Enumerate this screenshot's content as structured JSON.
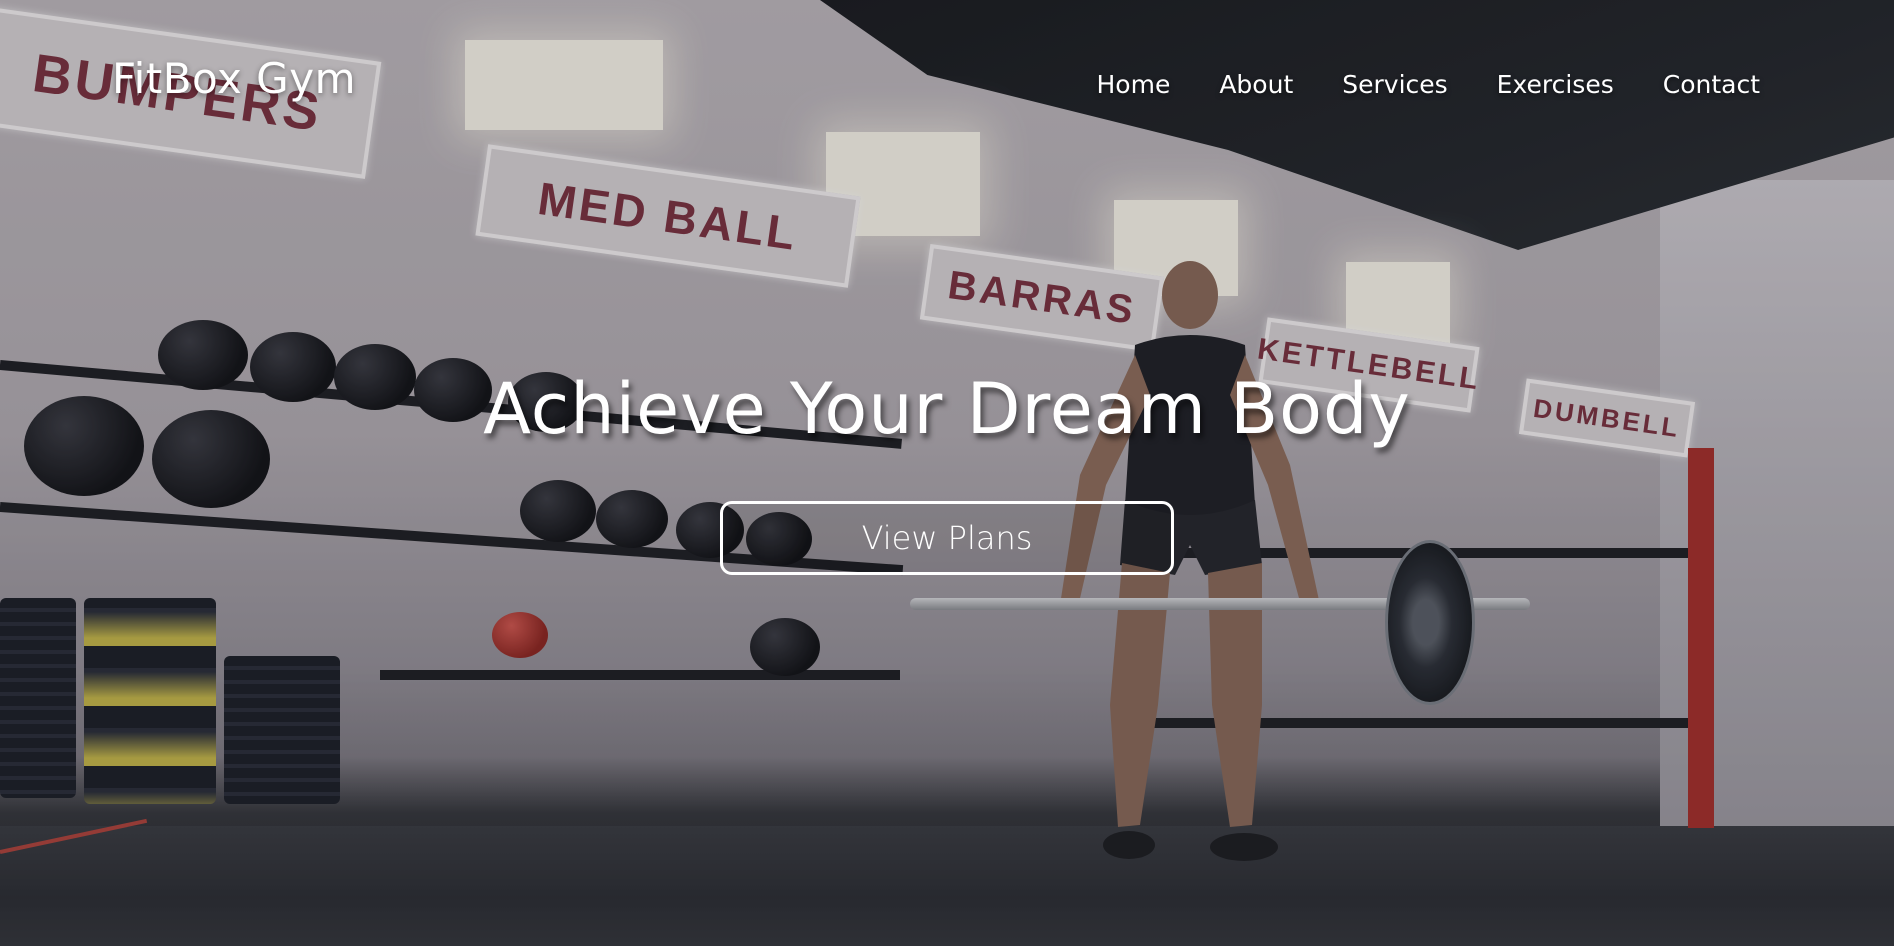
{
  "site": {
    "logo": "FitBox Gym"
  },
  "nav": {
    "items": [
      {
        "label": "Home"
      },
      {
        "label": "About"
      },
      {
        "label": "Services"
      },
      {
        "label": "Exercises"
      },
      {
        "label": "Contact"
      }
    ]
  },
  "hero": {
    "title": "Achieve Your Dream Body",
    "cta_label": "View Plans",
    "background": {
      "signs": [
        "BUMPERS",
        "MED BALL",
        "BARRAS",
        "KETTLEBELL",
        "DUMBELL"
      ]
    }
  }
}
